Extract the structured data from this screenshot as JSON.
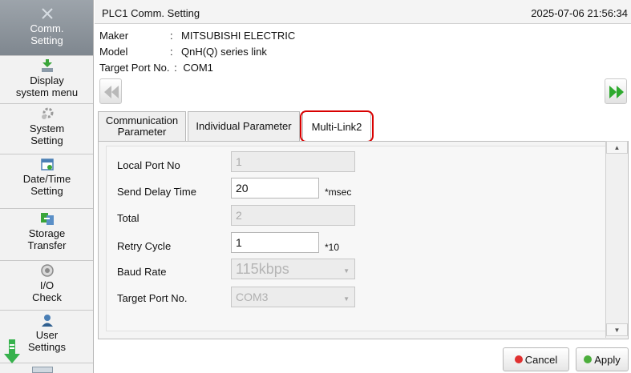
{
  "sidebar": {
    "items": [
      {
        "label": "Comm.\nSetting",
        "icon": "network-icon",
        "active": true
      },
      {
        "label": "Display\nsystem menu",
        "icon": "download-icon"
      },
      {
        "label": "System\nSetting",
        "icon": "gear-icon"
      },
      {
        "label": "Date/Time\nSetting",
        "icon": "calendar-icon"
      },
      {
        "label": "Storage\nTransfer",
        "icon": "transfer-icon"
      },
      {
        "label": "I/O\nCheck",
        "icon": "gauge-icon"
      },
      {
        "label": "User\nSettings",
        "icon": "user-icon"
      }
    ]
  },
  "header": {
    "title": "PLC1 Comm. Setting",
    "datetime": "2025-07-06 21:56:34"
  },
  "info": {
    "maker_label": "Maker",
    "maker_value": "MITSUBISHI ELECTRIC",
    "model_label": "Model",
    "model_value": "QnH(Q) series link",
    "port_label": "Target Port No.",
    "port_value": "COM1",
    "colon": ":"
  },
  "tabs": [
    {
      "label": "Communication\nParameter"
    },
    {
      "label": "Individual Parameter"
    },
    {
      "label": "Multi-Link2",
      "active": true
    }
  ],
  "form": {
    "local_port_label": "Local Port No",
    "local_port_value": "1",
    "send_delay_label": "Send Delay Time",
    "send_delay_value": "20",
    "send_delay_unit": "*msec",
    "total_label": "Total",
    "total_value": "2",
    "retry_label": "Retry Cycle",
    "retry_value": "1",
    "retry_unit": "*10",
    "baud_label": "Baud Rate",
    "baud_value": "115kbps",
    "target_label": "Target Port No.",
    "target_value": "COM3"
  },
  "buttons": {
    "cancel": "Cancel",
    "apply": "Apply"
  },
  "colors": {
    "highlight": "#d90000",
    "cancel_dot": "#e03030",
    "apply_dot": "#4cae3c",
    "nav_arrow_active": "#2faa2f",
    "nav_arrow_disabled": "#b9b9b9"
  }
}
